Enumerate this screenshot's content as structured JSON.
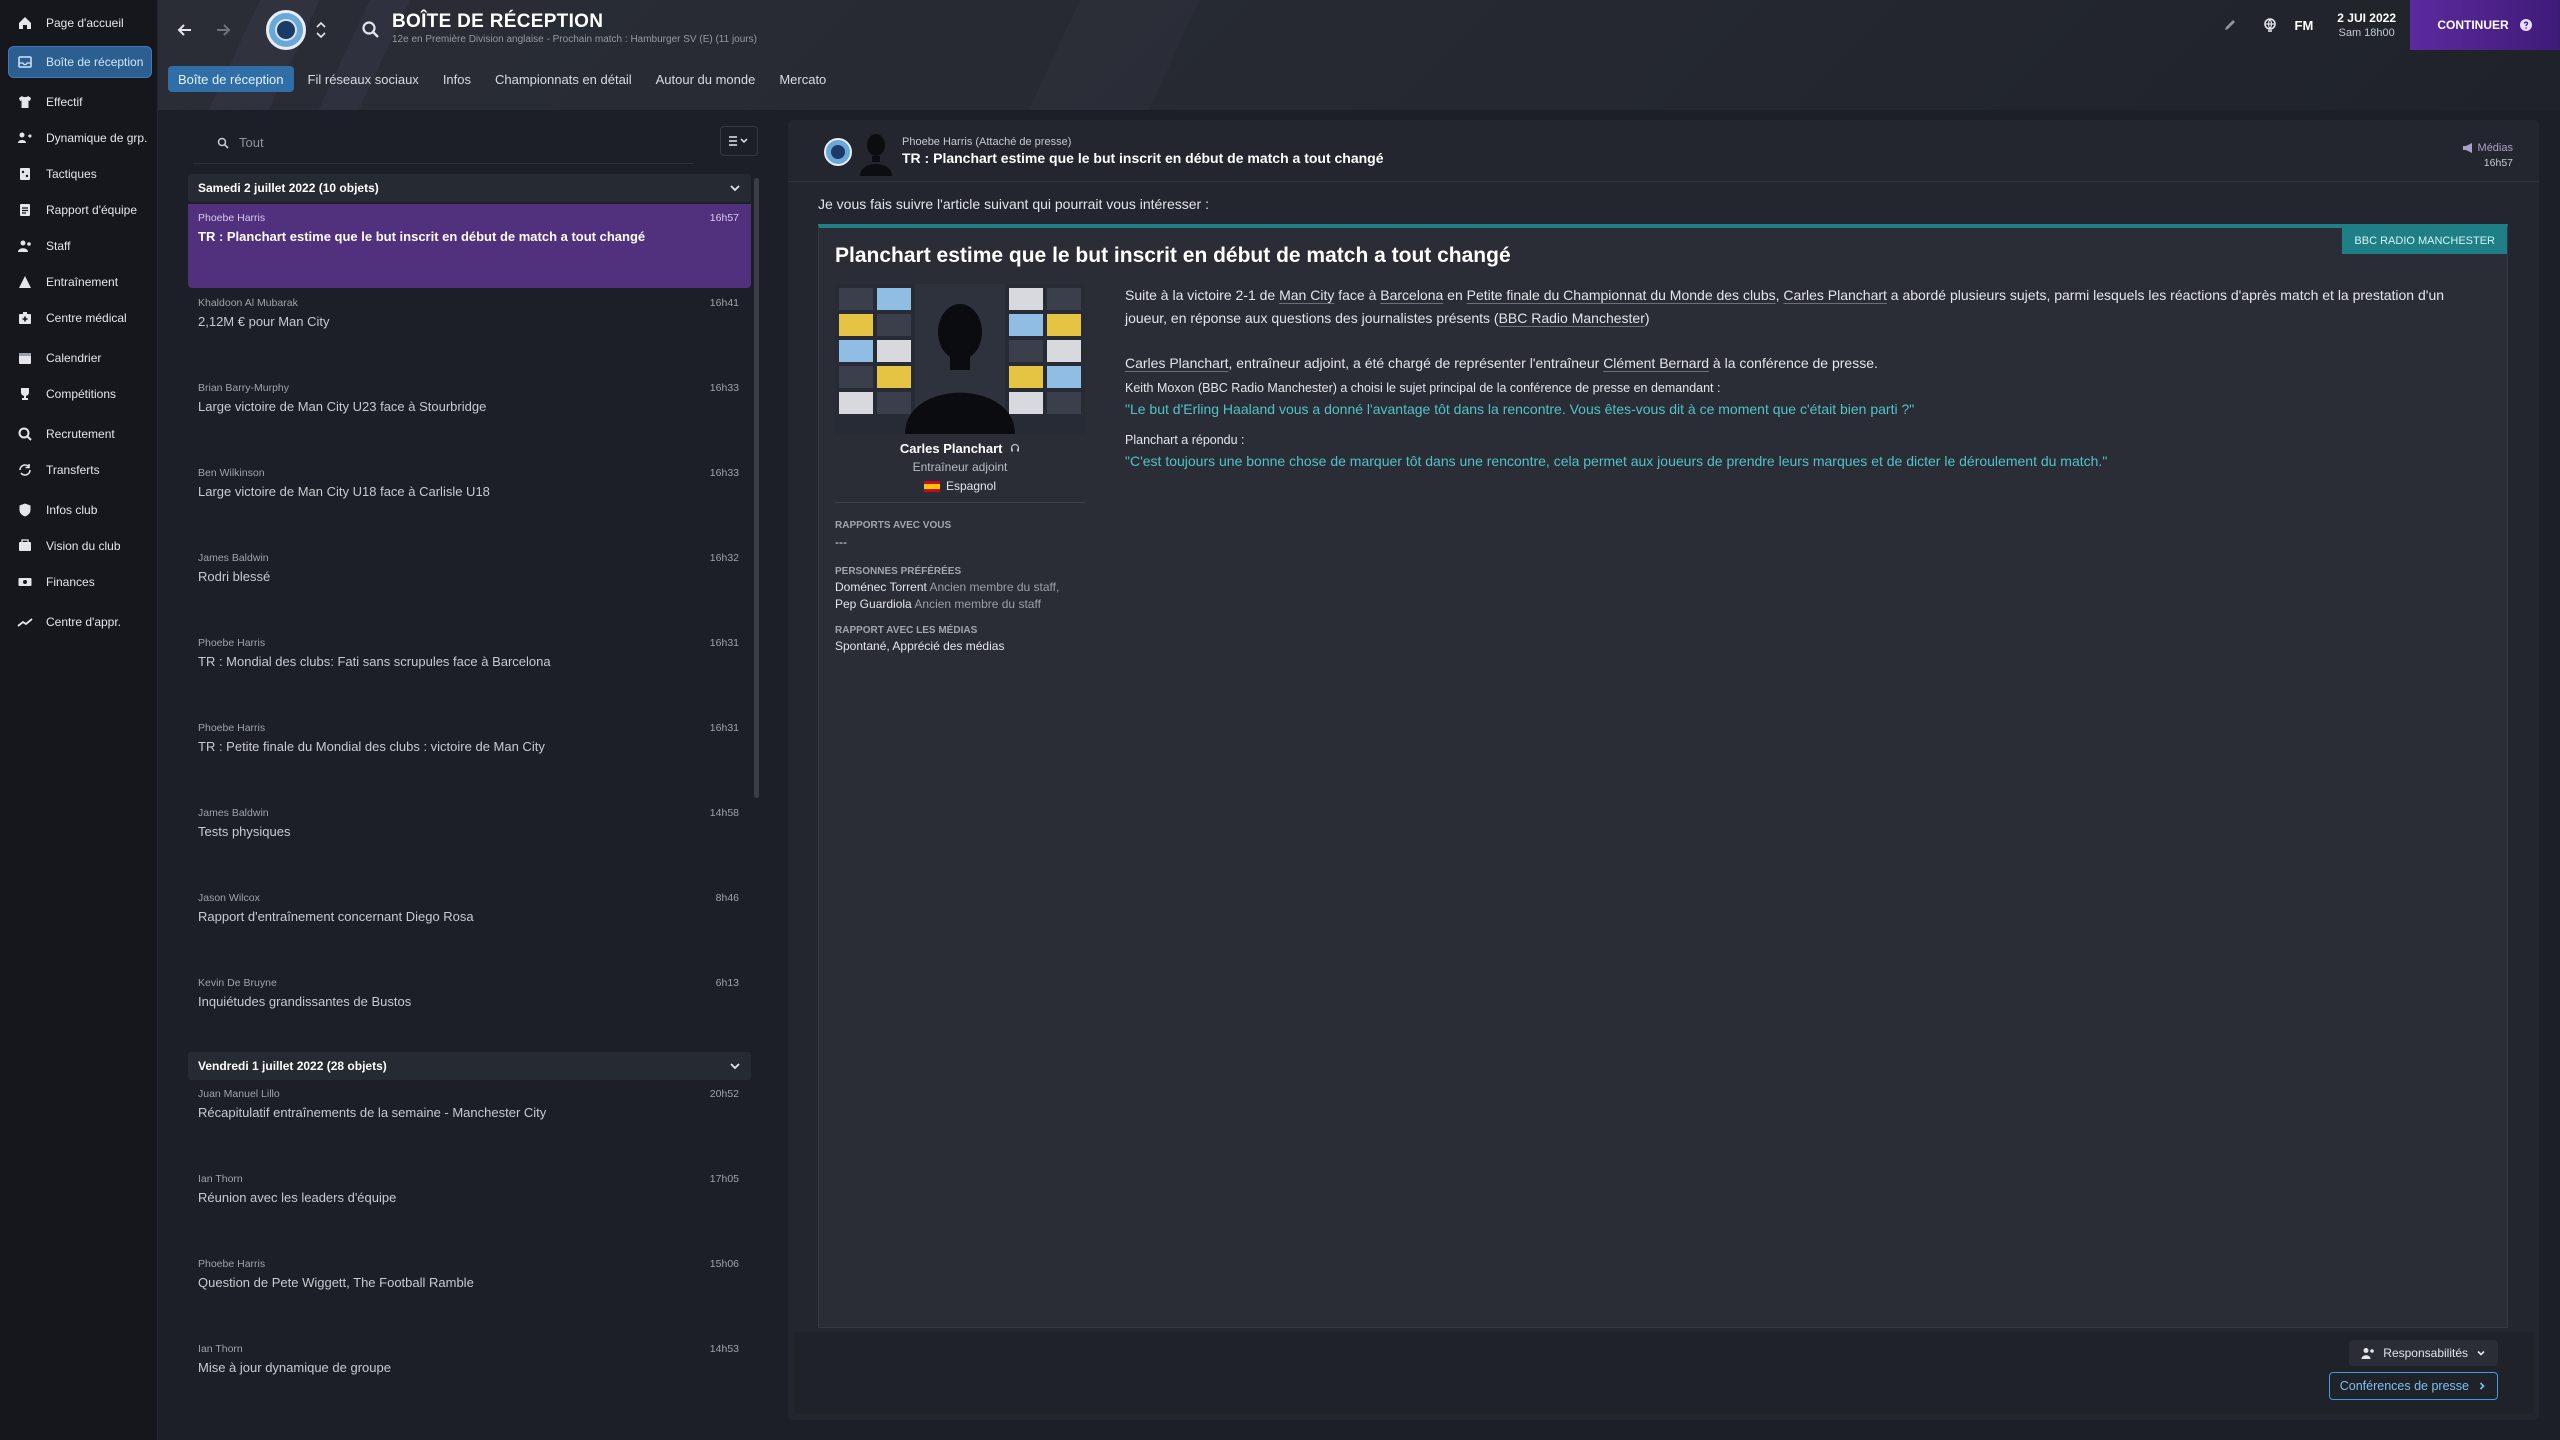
{
  "sidebar": {
    "items": [
      {
        "label": "Page d'accueil",
        "icon": "home-icon"
      },
      {
        "label": "Boîte de réception",
        "icon": "inbox-icon",
        "active": true
      },
      {
        "label": "Effectif",
        "icon": "shirt-icon"
      },
      {
        "label": "Dynamique de grp.",
        "icon": "dynamics-icon"
      },
      {
        "label": "Tactiques",
        "icon": "tactics-icon"
      },
      {
        "label": "Rapport d'équipe",
        "icon": "report-icon"
      },
      {
        "label": "Staff",
        "icon": "staff-icon"
      },
      {
        "label": "Entraînement",
        "icon": "training-icon"
      },
      {
        "label": "Centre médical",
        "icon": "medical-icon"
      },
      {
        "label": "Calendrier",
        "icon": "calendar-icon"
      },
      {
        "label": "Compétitions",
        "icon": "trophy-icon"
      },
      {
        "label": "Recrutement",
        "icon": "scouting-icon"
      },
      {
        "label": "Transferts",
        "icon": "transfers-icon"
      },
      {
        "label": "Infos club",
        "icon": "shield-icon"
      },
      {
        "label": "Vision du club",
        "icon": "vision-icon"
      },
      {
        "label": "Finances",
        "icon": "finances-icon"
      },
      {
        "label": "Centre d'appr.",
        "icon": "development-icon"
      }
    ]
  },
  "header": {
    "title": "BOÎTE DE RÉCEPTION",
    "subtitle": "12e en Première Division anglaise - Prochain match : Hamburger SV (E) (11 jours)",
    "tabs": [
      "Boîte de réception",
      "Fil réseaux sociaux",
      "Infos",
      "Championnats en détail",
      "Autour du monde",
      "Mercato"
    ],
    "fm_label": "FM",
    "date": "2 JUI 2022",
    "time": "Sam 18h00",
    "continue_label": "CONTINUER",
    "accent": "#5b2a9e"
  },
  "inbox": {
    "search_placeholder": "Tout",
    "groups": [
      {
        "label": "Samedi 2 juillet 2022 (10 objets)",
        "messages": [
          {
            "sender": "Phoebe Harris",
            "time": "16h57",
            "subject": "TR : Planchart estime que le but inscrit en début de match a tout changé",
            "active": true
          },
          {
            "sender": "Khaldoon Al Mubarak",
            "time": "16h41",
            "subject": "2,12M € pour Man City"
          },
          {
            "sender": "Brian Barry-Murphy",
            "time": "16h33",
            "subject": "Large victoire de Man City U23 face à Stourbridge"
          },
          {
            "sender": "Ben Wilkinson",
            "time": "16h33",
            "subject": "Large victoire de Man City U18 face à Carlisle U18"
          },
          {
            "sender": "James Baldwin",
            "time": "16h32",
            "subject": "Rodri blessé"
          },
          {
            "sender": "Phoebe Harris",
            "time": "16h31",
            "subject": "TR : Mondial des clubs: Fati sans scrupules face à Barcelona"
          },
          {
            "sender": "Phoebe Harris",
            "time": "16h31",
            "subject": "TR : Petite finale du Mondial des clubs : victoire de Man City"
          },
          {
            "sender": "James Baldwin",
            "time": "14h58",
            "subject": "Tests physiques"
          },
          {
            "sender": "Jason Wilcox",
            "time": "8h46",
            "subject": "Rapport d'entraînement concernant Diego Rosa"
          },
          {
            "sender": "Kevin De Bruyne",
            "time": "6h13",
            "subject": "Inquiétudes grandissantes de Bustos"
          }
        ]
      },
      {
        "label": "Vendredi 1 juillet 2022 (28 objets)",
        "messages": [
          {
            "sender": "Juan Manuel Lillo",
            "time": "20h52",
            "subject": "Récapitulatif entraînements de la semaine - Manchester City"
          },
          {
            "sender": "Ian Thorn",
            "time": "17h05",
            "subject": "Réunion avec les leaders d'équipe"
          },
          {
            "sender": "Phoebe Harris",
            "time": "15h06",
            "subject": "Question de Pete Wiggett, The Football Ramble"
          },
          {
            "sender": "Ian Thorn",
            "time": "14h53",
            "subject": "Mise à jour dynamique de groupe"
          }
        ]
      }
    ]
  },
  "message": {
    "from": "Phoebe Harris  (Attaché de presse)",
    "subject": "TR : Planchart estime que le but inscrit en début de match a tout changé",
    "category": "Médias",
    "time": "16h57",
    "intro": "Je vous fais suivre l'article suivant qui pourrait vous intéresser :",
    "article": {
      "source": "BBC RADIO MANCHESTER",
      "title": "Planchart estime que le but inscrit en début de match a tout changé",
      "person": {
        "name": "Carles Planchart",
        "role": "Entraîneur adjoint",
        "nationality": "Espagnol"
      },
      "reports_label": "RAPPORTS AVEC VOUS",
      "reports_value": "---",
      "favs_label": "PERSONNES PRÉFÉRÉES",
      "favs": [
        {
          "name": "Doménec Torrent",
          "desc": "Ancien membre du staff,"
        },
        {
          "name": "Pep Guardiola",
          "desc": "Ancien membre du staff"
        }
      ],
      "media_label": "RAPPORT AVEC LES MÉDIAS",
      "media_value": "Spontané, Apprécié des médias",
      "p1": {
        "a": "Suite à la victoire 2-1 de ",
        "b": "Man City",
        "c": " face à ",
        "d": "Barcelona",
        "e": " en ",
        "f": "Petite finale du Championnat du Monde des clubs",
        "g": ", ",
        "h": "Carles Planchart",
        "i": " a abordé plusieurs sujets, parmi lesquels les réactions d'après match et la prestation d'un joueur, en réponse aux questions des journalistes présents (",
        "j": "BBC Radio Manchester",
        "k": ")"
      },
      "p2": {
        "a": "Carles Planchart",
        "b": ", entraîneur adjoint, a été chargé de représenter l'entraîneur ",
        "c": "Clément Bernard",
        "d": " à la conférence de presse."
      },
      "p3": "Keith Moxon (BBC Radio Manchester) a choisi le sujet principal de la conférence de presse en demandant :",
      "q1": "\"Le but d'Erling Haaland vous a donné l'avantage tôt dans la rencontre. Vous êtes-vous dit à ce moment que c'était bien parti ?\"",
      "p4": "Planchart a répondu :",
      "q2": "\"C'est toujours une bonne chose de marquer tôt dans une rencontre, cela permet aux joueurs de prendre leurs marques et de dicter le déroulement du match.\""
    },
    "footer": {
      "responsibilities": "Responsabilités",
      "press": "Conférences de presse"
    }
  }
}
